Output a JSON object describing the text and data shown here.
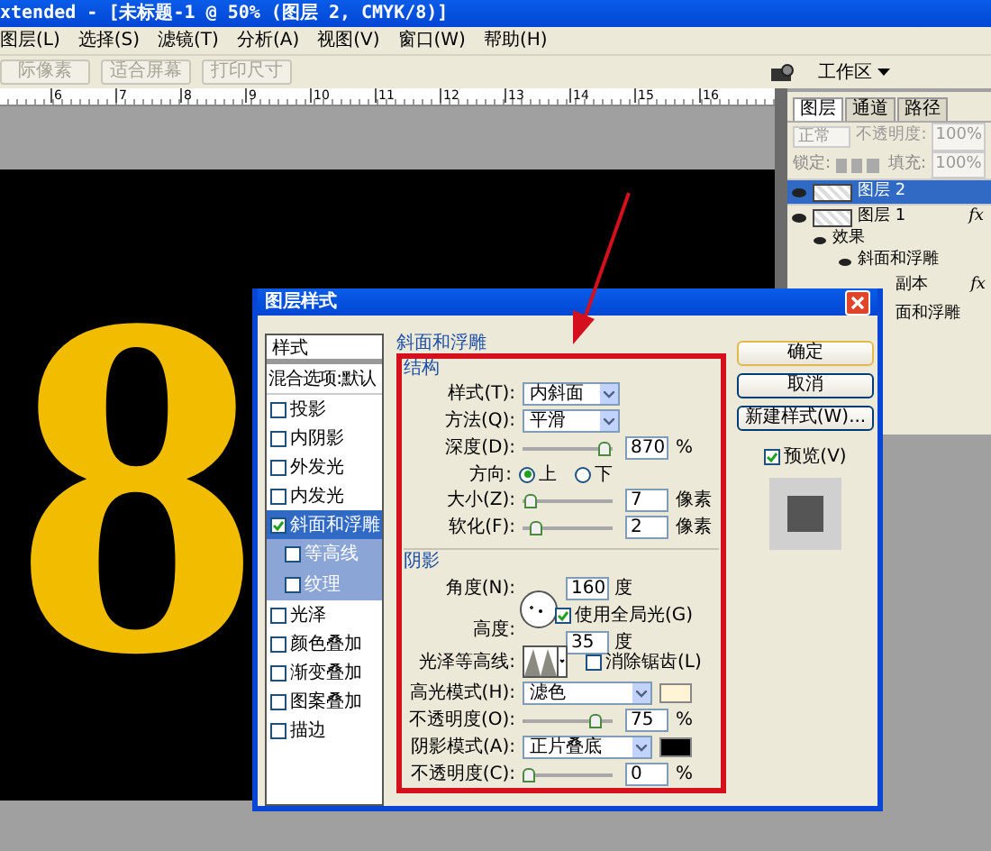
{
  "window": {
    "title": "xtended - [未标题-1 @ 50% (图层 2, CMYK/8)]"
  },
  "menu": [
    "图层(L)",
    "选择(S)",
    "滤镜(T)",
    "分析(A)",
    "视图(V)",
    "窗口(W)",
    "帮助(H)"
  ],
  "options_bar": {
    "buttons": [
      {
        "label": "际像素",
        "disabled": true
      },
      {
        "label": "适合屏幕",
        "disabled": true
      },
      {
        "label": "打印尺寸",
        "disabled": true
      }
    ],
    "workspace": "工作区"
  },
  "ruler": [
    "6",
    "7",
    "8",
    "9",
    "10",
    "11",
    "12",
    "13",
    "14",
    "15",
    "16"
  ],
  "canvas": {
    "glyph": "8"
  },
  "layers_panel": {
    "tabs": [
      {
        "label": "图层",
        "selected": true
      },
      {
        "label": "通道",
        "selected": false
      },
      {
        "label": "路径",
        "selected": false
      }
    ],
    "blend_mode": "正常",
    "opacity_label": "不透明度:",
    "opacity": "100%",
    "lock_label": "锁定:",
    "fill_label": "填充:",
    "fill": "100%",
    "layers": [
      {
        "name": "图层 2",
        "selected": true
      },
      {
        "name": "图层 1",
        "selected": false,
        "badge": "fx",
        "children": [
          {
            "name": "效果",
            "children": [
              {
                "name": "斜面和浮雕"
              }
            ]
          }
        ]
      }
    ],
    "covered_rows": [
      {
        "name": "副本",
        "badge": "fx"
      },
      {
        "name": "面和浮雕"
      }
    ]
  },
  "dialog": {
    "title": "图层样式",
    "styles": [
      {
        "kind": "header",
        "label": "样式"
      },
      {
        "kind": "plain",
        "label": "混合选项:默认"
      },
      {
        "kind": "check",
        "label": "投影",
        "checked": false,
        "selected": false
      },
      {
        "kind": "check",
        "label": "内阴影",
        "checked": false,
        "selected": false
      },
      {
        "kind": "check",
        "label": "外发光",
        "checked": false,
        "selected": false
      },
      {
        "kind": "check",
        "label": "内发光",
        "checked": false,
        "selected": false
      },
      {
        "kind": "check",
        "label": "斜面和浮雕",
        "checked": true,
        "selected": true,
        "children": [
          {
            "label": "等高线",
            "checked": false
          },
          {
            "label": "纹理",
            "checked": false
          }
        ]
      },
      {
        "kind": "check",
        "label": "光泽",
        "checked": false,
        "selected": false
      },
      {
        "kind": "check",
        "label": "颜色叠加",
        "checked": false,
        "selected": false
      },
      {
        "kind": "check",
        "label": "渐变叠加",
        "checked": false,
        "selected": false
      },
      {
        "kind": "check",
        "label": "图案叠加",
        "checked": false,
        "selected": false
      },
      {
        "kind": "check",
        "label": "描边",
        "checked": false,
        "selected": false
      }
    ],
    "group_title": "斜面和浮雕",
    "structure": {
      "title": "结构",
      "style": {
        "label": "样式(T):",
        "value": "内斜面"
      },
      "technique": {
        "label": "方法(Q):",
        "value": "平滑"
      },
      "depth": {
        "label": "深度(D):",
        "level": 0.97,
        "value": "870",
        "unit": "%"
      },
      "direction": {
        "label": "方向:",
        "options": [
          {
            "label": "上",
            "selected": true
          },
          {
            "label": "下",
            "selected": false
          }
        ]
      },
      "size": {
        "label": "大小(Z):",
        "level": 0.02,
        "value": "7",
        "unit": "像素"
      },
      "soften": {
        "label": "软化(F):",
        "level": 0.1,
        "value": "2",
        "unit": "像素"
      }
    },
    "shading": {
      "title": "阴影",
      "angle": {
        "label": "角度(N):",
        "value": "160",
        "unit": "度"
      },
      "global_light": {
        "label": "使用全局光(G)",
        "checked": true
      },
      "altitude": {
        "label": "高度:",
        "value": "35",
        "unit": "度"
      },
      "gloss_contour": {
        "label": "光泽等高线:"
      },
      "anti_alias": {
        "label": "消除锯齿(L)",
        "checked": false
      },
      "highlight_mode": {
        "label": "高光模式(H):",
        "value": "滤色",
        "color": "#fff5d6"
      },
      "highlight_opacity": {
        "label": "不透明度(O):",
        "level": 0.85,
        "value": "75",
        "unit": "%"
      },
      "shadow_mode": {
        "label": "阴影模式(A):",
        "value": "正片叠底",
        "color": "#000000"
      },
      "shadow_opacity": {
        "label": "不透明度(C):",
        "level": 0,
        "value": "0",
        "unit": "%"
      }
    },
    "buttons": [
      "确定",
      "取消",
      "新建样式(W)..."
    ],
    "preview": {
      "label": "预览(V)",
      "checked": true
    }
  }
}
